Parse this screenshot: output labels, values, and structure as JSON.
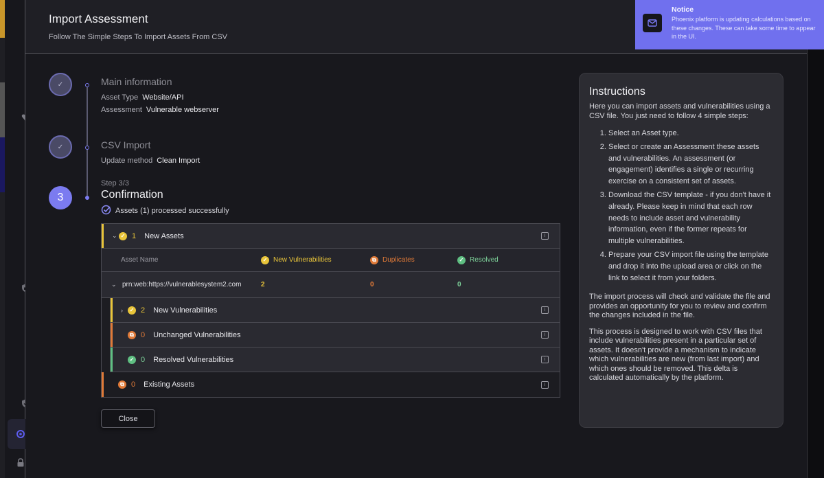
{
  "modal": {
    "title": "Import Assessment",
    "subtitle": "Follow The Simple Steps To Import Assets From CSV"
  },
  "steps": [
    {
      "title": "Main information",
      "state": "done",
      "fields": [
        {
          "label": "Asset Type",
          "value": "Website/API"
        },
        {
          "label": "Assessment",
          "value": "Vulnerable webserver"
        }
      ]
    },
    {
      "title": "CSV Import",
      "state": "done",
      "fields": [
        {
          "label": "Update method",
          "value": "Clean Import"
        }
      ]
    },
    {
      "number": "3",
      "step_label": "Step 3/3",
      "title": "Confirmation",
      "state": "current",
      "status": "Assets (1) processed successfully"
    }
  ],
  "results": {
    "new_assets": {
      "count": "1",
      "label": "New Assets"
    },
    "columns": {
      "asset_name": "Asset Name",
      "new_vulnerabilities": "New Vulnerabilities",
      "duplicates": "Duplicates",
      "resolved": "Resolved"
    },
    "assets": [
      {
        "name": "prn:web:https://vulnerablesystem2.com",
        "new": "2",
        "duplicates": "0",
        "resolved": "0"
      }
    ],
    "sub_groups": [
      {
        "count": "2",
        "label": "New Vulnerabilities"
      },
      {
        "count": "0",
        "label": "Unchanged Vulnerabilities"
      },
      {
        "count": "0",
        "label": "Resolved Vulnerabilities"
      }
    ],
    "existing_assets": {
      "count": "0",
      "label": "Existing Assets"
    }
  },
  "close_label": "Close",
  "instructions": {
    "title": "Instructions",
    "intro": "Here you can import assets and vulnerabilities using a CSV file. You just need to follow 4 simple steps:",
    "steps": [
      "Select an Asset type.",
      "Select or create an Assessment these assets and vulnerabilities. An assessment (or engagement) identifies a single or recurring exercise on a consistent set of assets.",
      "Download the CSV template - if you don't have it already. Please keep in mind that each row needs to include asset and vulnerability information, even if the former repeats for multiple vulnerabilities.",
      "Prepare your CSV import file using the template and drop it into the upload area or click on the link to select it from your folders."
    ],
    "paragraph_1": "The import process will check and validate the file and provides an opportunity for you to review and confirm the changes included in the file.",
    "paragraph_2": "This process is designed to work with CSV files that include vulnerabilities present in a particular set of assets. It doesn't provide a mechanism to indicate which vulnerabilities are new (from last import) and which ones should be removed. This delta is calculated automatically by the platform."
  },
  "notice": {
    "title": "Notice",
    "text": "Phoenix platform is updating calculations based on these changes. These can take some time to appear in the UI."
  },
  "colors": {
    "accent": "#7b7bf0",
    "notice_bg": "#7070ee",
    "new": "#e8c43a",
    "duplicate": "#e07a38",
    "resolved": "#5fbf82"
  }
}
